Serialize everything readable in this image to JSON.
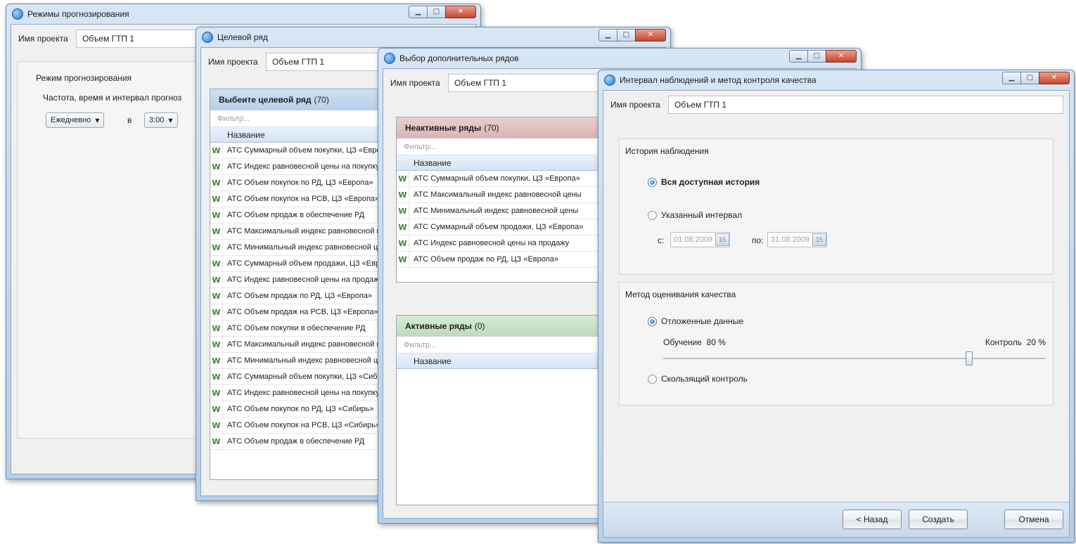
{
  "project_label": "Имя проекта",
  "project_value": "Объем ГТП 1",
  "window1": {
    "title": "Режимы прогнозирования",
    "group_title": "Режим прогнозирования",
    "freq_label": "Частота, время и интервал прогноз",
    "frequency": "Ежедневно",
    "at_label": "в",
    "time": "3:00"
  },
  "window2": {
    "title": "Целевой ряд",
    "list_title": "Выбеите целевой ряд",
    "list_count": "(70)",
    "filter_placeholder": "Фильтр...",
    "column_name": "Название",
    "rows": [
      "АТС Суммарный объем покупки, ЦЗ «Европа»",
      "АТС Индекс равновесной цены на покупку",
      "АТС Объем покупок по РД, ЦЗ «Европа»",
      "АТС Объем покупок на РСВ, ЦЗ «Европа»",
      "АТС Объем продаж в обеспечение РД",
      "АТС Максимальный индекс равновесной цены",
      "АТС Минимальный индекс равновесной цены",
      "АТС Суммарный объем продажи, ЦЗ «Европа»",
      "АТС Индекс равновесной цены на продажу",
      "АТС Объем продаж по РД, ЦЗ «Европа»",
      "АТС Объем продаж на РСВ, ЦЗ «Европа»",
      "АТС Объем покупки в обеспечение РД",
      "АТС Максимальный индекс равновесной цены",
      "АТС Минимальный индекс равновесной цены",
      "АТС Суммарный объем покупки, ЦЗ «Сибирь»",
      "АТС Индекс равновесной цены на покупку",
      "АТС Объем покупок по РД, ЦЗ «Сибирь»",
      "АТС Объем покупок на РСВ, ЦЗ «Сибирь»",
      "АТС Объем продаж в обеспечение РД"
    ]
  },
  "window3": {
    "title": "Выбор дополнительных рядов",
    "inactive_title": "Неактивные ряды",
    "inactive_count": "(70)",
    "active_title": "Активные ряды",
    "active_count": "(0)",
    "filter_placeholder": "Фильтр...",
    "column_name": "Название",
    "inactive_rows": [
      "АТС Суммарный объем покупки, ЦЗ «Европа»",
      "АТС Максимальный индекс равновесной цены",
      "АТС Минимальный индекс равновесной цены",
      "АТС Суммарный объем продажи, ЦЗ «Европа»",
      "АТС Индекс равновесной цены на продажу",
      "АТС Объем продаж по РД, ЦЗ «Европа»"
    ]
  },
  "window4": {
    "title": "Интервал наблюдений и метод контроля качества",
    "history_group": "История наблюдения",
    "opt_all_history": "Вся доступная история",
    "opt_interval": "Указанный интервал",
    "from_label": "с:",
    "from_date": "01.08.2009",
    "to_label": "по:",
    "to_date": "31.08.2009",
    "cal_day": "15",
    "quality_group": "Метод оценивания качества",
    "opt_holdout": "Отложенные данные",
    "train_label": "Обучение",
    "train_value": "80 %",
    "control_label": "Контроль",
    "control_value": "20 %",
    "train_fraction": 0.8,
    "opt_cross": "Скользящий контроль",
    "btn_back": "< Назад",
    "btn_create": "Создать",
    "btn_cancel": "Отмена"
  },
  "icons": {
    "app": "app-logo-icon",
    "series": "series-icon",
    "minimize": "minimize-icon",
    "maximize": "maximize-icon",
    "close": "close-icon",
    "dropdown": "chevron-down-icon",
    "calendar": "calendar-icon"
  }
}
